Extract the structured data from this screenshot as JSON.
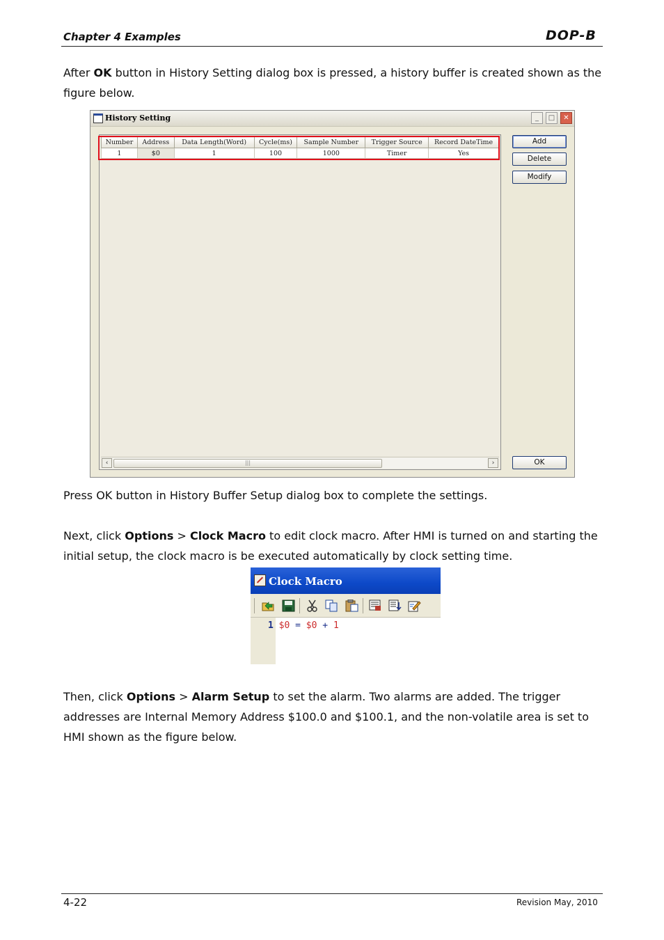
{
  "header": {
    "chapter": "Chapter 4 Examples",
    "logo": "DOP-B"
  },
  "paragraphs": {
    "p1": {
      "before": "After ",
      "bold1": "OK",
      "after": " button in History Setting dialog box is pressed, a history buffer is created shown as the figure below."
    },
    "p2": "Press OK button in History Buffer Setup dialog box to complete the settings.",
    "p3": {
      "before": "Next, click ",
      "bold1": "Options",
      "mid1": " > ",
      "bold2": "Clock Macro",
      "after": " to edit clock macro. After HMI is turned on and starting the initial setup, the clock macro is be executed automatically by clock setting time."
    },
    "p4": {
      "before": "Then, click ",
      "bold1": "Options",
      "mid1": " > ",
      "bold2": "Alarm Setup",
      "after": " to set the alarm. Two alarms are added. The trigger addresses are Internal Memory Address $100.0 and $100.1, and the non-volatile area is set to HMI shown as the figure below."
    }
  },
  "history_dialog": {
    "title": "History Setting",
    "columns": [
      "Number",
      "Address",
      "Data Length(Word)",
      "Cycle(ms)",
      "Sample Number",
      "Trigger Source",
      "Record DateTime"
    ],
    "rows": [
      [
        "1",
        "$0",
        "1",
        "100",
        "1000",
        "Timer",
        "Yes"
      ]
    ],
    "buttons": {
      "add": "Add",
      "delete": "Delete",
      "modify": "Modify",
      "ok": "OK"
    },
    "window_controls": {
      "minimize": "_",
      "maximize": "□",
      "close": "✕"
    },
    "scroll_left": "‹",
    "scroll_right": "›",
    "scroll_grip": "|||",
    "highlight_color": "#e0101c"
  },
  "clock_macro": {
    "title": "Clock Macro",
    "toolbar_icons": [
      "open-folder-icon",
      "save-icon",
      "cut-icon",
      "copy-icon",
      "paste-icon",
      "view-icon",
      "compile-icon",
      "edit-icon"
    ],
    "line_number": "1",
    "code_tokens": {
      "lhs": "$0",
      "op": "=",
      "rhs": "$0",
      "plus": "+",
      "num": "1"
    },
    "titlebar_color": "#0d49c8"
  },
  "footer": {
    "page": "4-22",
    "revision": "Revision May, 2010"
  }
}
